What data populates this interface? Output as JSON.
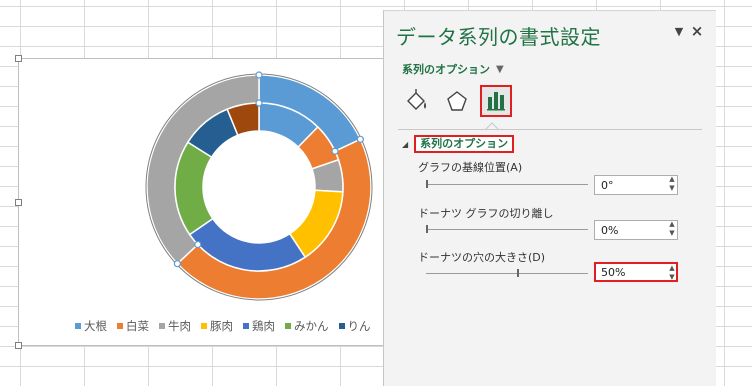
{
  "panel": {
    "title": "データ系列の書式設定",
    "menu_icon": "dropdown-triangle-icon",
    "close_label": "×",
    "options_dropdown_label": "系列のオプション",
    "tabs": [
      {
        "name": "fill-line",
        "icon": "paint-bucket-icon"
      },
      {
        "name": "effects",
        "icon": "pentagon-icon"
      },
      {
        "name": "series-options",
        "icon": "bar-chart-icon",
        "selected": true
      }
    ],
    "section_title": "系列のオプション",
    "options": [
      {
        "label": "グラフの基線位置(A)",
        "value": "0°",
        "slider_fraction": 0.0
      },
      {
        "label": "ドーナツ グラフの切り離し",
        "value": "0%",
        "slider_fraction": 0.0
      },
      {
        "label": "ドーナツの穴の大きさ(D)",
        "value": "50%",
        "slider_fraction": 0.56
      }
    ]
  },
  "colors": {
    "accent": "#217346",
    "highlight": "#e02020"
  },
  "chart_data": {
    "type": "doughnut",
    "categories": [
      "大根",
      "白菜",
      "牛肉",
      "豚肉",
      "鶏肉",
      "みかん",
      "りん"
    ],
    "series": [
      {
        "ring": "outer",
        "values": [
          18,
          45,
          37
        ],
        "colors": [
          "#5b9bd5",
          "#ed7d31",
          "#a5a5a5"
        ]
      },
      {
        "ring": "inner",
        "values": [
          10,
          6,
          5,
          12,
          20,
          15,
          8,
          5
        ],
        "colors": [
          "#5b9bd5",
          "#ed7d31",
          "#a5a5a5",
          "#ffc000",
          "#4472c4",
          "#70ad47",
          "#255e91",
          "#9e480e"
        ]
      }
    ],
    "legend": {
      "placement": "bottom",
      "colors": [
        "#5b9bd5",
        "#ed7d31",
        "#a5a5a5",
        "#ffc000",
        "#4472c4",
        "#70ad47",
        "#255e91"
      ]
    }
  }
}
